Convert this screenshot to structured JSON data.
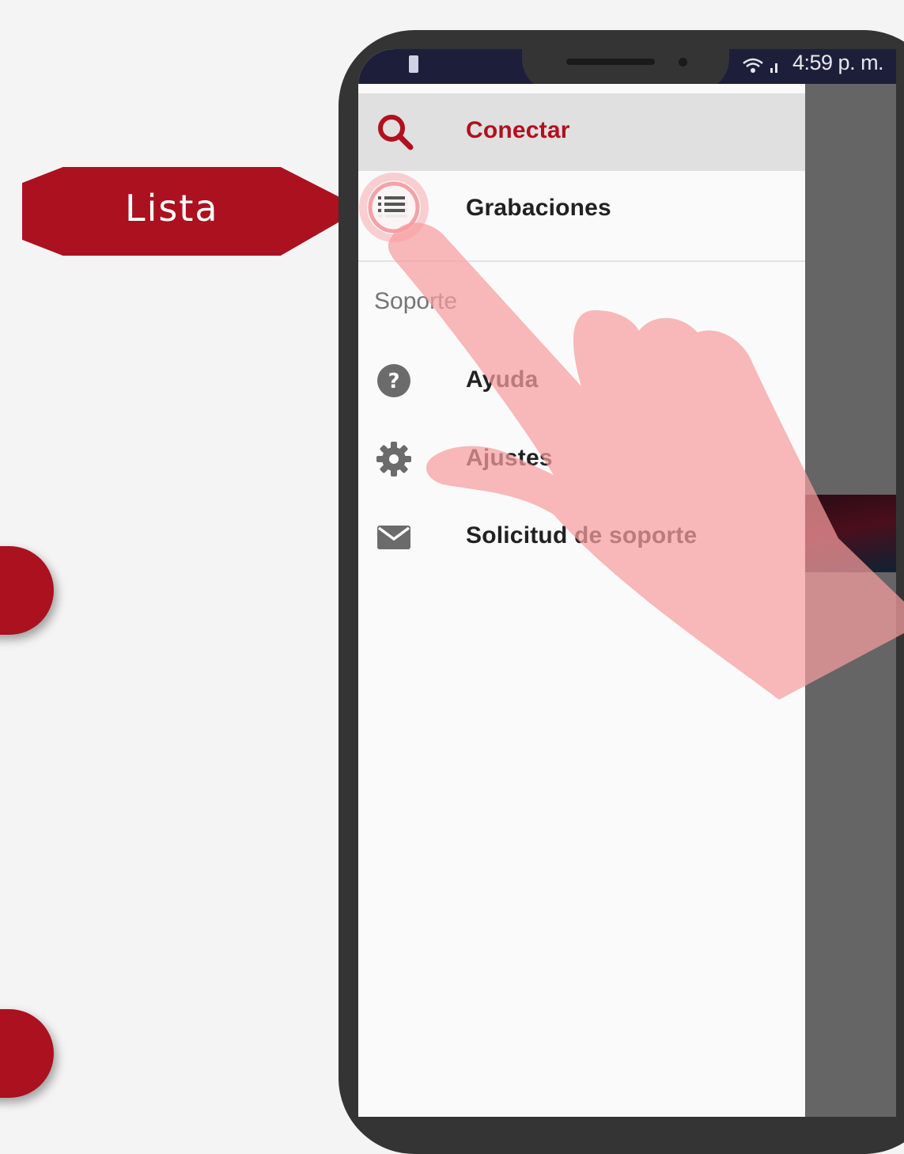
{
  "callouts": {
    "lista_label": "Lista"
  },
  "status_bar": {
    "time": "4:59 p. m.",
    "icons": [
      "battery-icon",
      "wifi-icon",
      "signal-icon"
    ]
  },
  "drawer": {
    "items": [
      {
        "label": "Conectar",
        "icon": "search-icon",
        "active": true
      },
      {
        "label": "Grabaciones",
        "icon": "list-icon",
        "active": false
      }
    ],
    "section_header": "Soporte",
    "support_items": [
      {
        "label": "Ayuda",
        "icon": "help-icon"
      },
      {
        "label": "Ajustes",
        "icon": "gear-icon"
      },
      {
        "label": "Solicitud de soporte",
        "icon": "mail-icon"
      }
    ]
  },
  "colors": {
    "accent": "#b1101e",
    "callout": "#ab111f",
    "phone_frame": "#343434",
    "scrim": "#656565",
    "hand_overlay": "#f79d9e"
  }
}
